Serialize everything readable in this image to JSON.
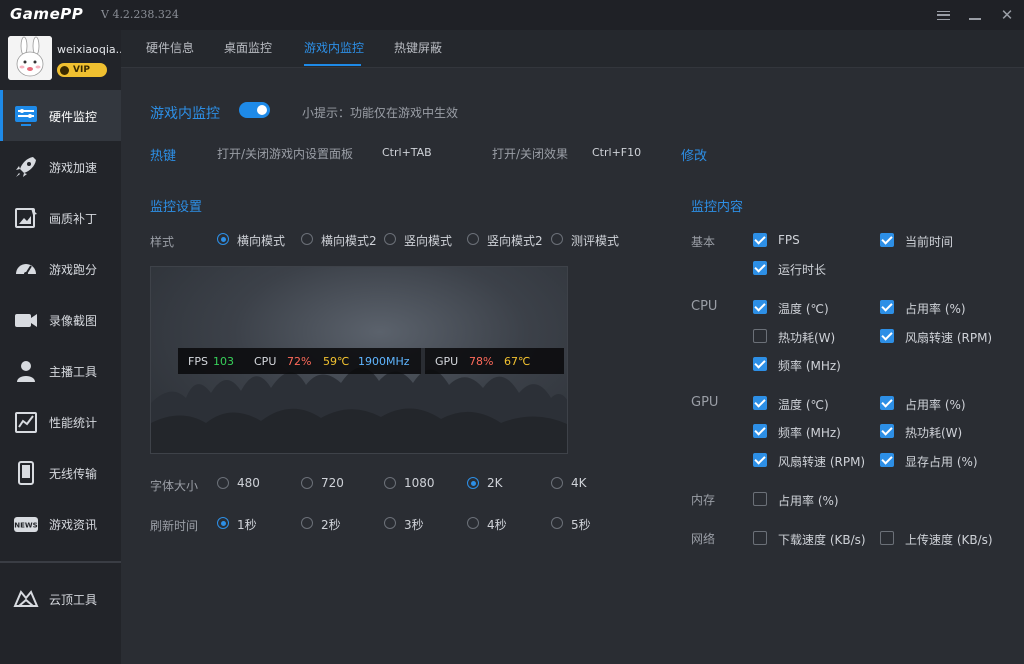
{
  "app": {
    "logo": "GamePP",
    "version": "V 4.2.238.324"
  },
  "user": {
    "name": "weixiaoqia...",
    "badge": "VIP"
  },
  "sidebar": {
    "items": [
      {
        "label": "硬件监控",
        "icon": "monitor-sliders-icon"
      },
      {
        "label": "游戏加速",
        "icon": "rocket-icon"
      },
      {
        "label": "画质补丁",
        "icon": "image-patch-icon"
      },
      {
        "label": "游戏跑分",
        "icon": "speedometer-icon"
      },
      {
        "label": "录像截图",
        "icon": "camera-icon"
      },
      {
        "label": "主播工具",
        "icon": "streamer-icon"
      },
      {
        "label": "性能统计",
        "icon": "stats-chart-icon"
      },
      {
        "label": "无线传输",
        "icon": "phone-icon"
      },
      {
        "label": "游戏资讯",
        "icon": "news-icon"
      },
      {
        "label": "云顶工具",
        "icon": "cloud-tool-icon"
      }
    ]
  },
  "tabs": [
    "硬件信息",
    "桌面监控",
    "游戏内监控",
    "热键屏蔽"
  ],
  "ingame": {
    "title": "游戏内监控",
    "tip": "小提示：功能仅在游戏中生效",
    "enabled": true
  },
  "hotkeys": {
    "label": "热键",
    "panel_label": "打开/关闭游戏内设置面板",
    "panel_key": "Ctrl+TAB",
    "effect_label": "打开/关闭效果",
    "effect_key": "Ctrl+F10",
    "modify": "修改"
  },
  "settings": {
    "title": "监控设置",
    "style_label": "样式",
    "styles": [
      "横向模式",
      "横向模式2",
      "竖向模式",
      "竖向模式2",
      "测评模式"
    ],
    "style_selected": "横向模式",
    "font_label": "字体大小",
    "font_sizes": [
      "480",
      "720",
      "1080",
      "2K",
      "4K"
    ],
    "font_selected": "2K",
    "refresh_label": "刷新时间",
    "refresh_options": [
      "1秒",
      "2秒",
      "3秒",
      "4秒",
      "5秒"
    ],
    "refresh_selected": "1秒"
  },
  "osd": {
    "fps_label": "FPS",
    "fps": "103",
    "cpu_label": "CPU",
    "cpu_usage": "72%",
    "cpu_temp": "59℃",
    "cpu_freq": "1900MHz",
    "gpu_label": "GPU",
    "gpu_usage": "78%",
    "gpu_temp": "67℃"
  },
  "content": {
    "title": "监控内容",
    "groups": [
      {
        "label": "基本",
        "items": [
          {
            "label": "FPS",
            "checked": true
          },
          {
            "label": "当前时间",
            "checked": true
          },
          {
            "label": "运行时长",
            "checked": true
          }
        ]
      },
      {
        "label": "CPU",
        "items": [
          {
            "label": "温度 (℃)",
            "checked": true
          },
          {
            "label": "占用率 (%)",
            "checked": true
          },
          {
            "label": "热功耗(W)",
            "checked": false
          },
          {
            "label": "风扇转速 (RPM)",
            "checked": true
          },
          {
            "label": "频率 (MHz)",
            "checked": true
          }
        ]
      },
      {
        "label": "GPU",
        "items": [
          {
            "label": "温度 (℃)",
            "checked": true
          },
          {
            "label": "占用率 (%)",
            "checked": true
          },
          {
            "label": "频率 (MHz)",
            "checked": true
          },
          {
            "label": "热功耗(W)",
            "checked": true
          },
          {
            "label": "风扇转速 (RPM)",
            "checked": true
          },
          {
            "label": "显存占用 (%)",
            "checked": true
          }
        ]
      },
      {
        "label": "内存",
        "items": [
          {
            "label": "占用率 (%)",
            "checked": false
          }
        ]
      },
      {
        "label": "网络",
        "items": [
          {
            "label": "下载速度 (KB/s)",
            "checked": false
          },
          {
            "label": "上传速度 (KB/s)",
            "checked": false
          }
        ]
      }
    ]
  },
  "colors": {
    "accent": "#1e8ae8",
    "fps": "#37d05a",
    "usage": "#ff6a5a",
    "temp": "#f2c230",
    "freq": "#5fb6ff"
  }
}
